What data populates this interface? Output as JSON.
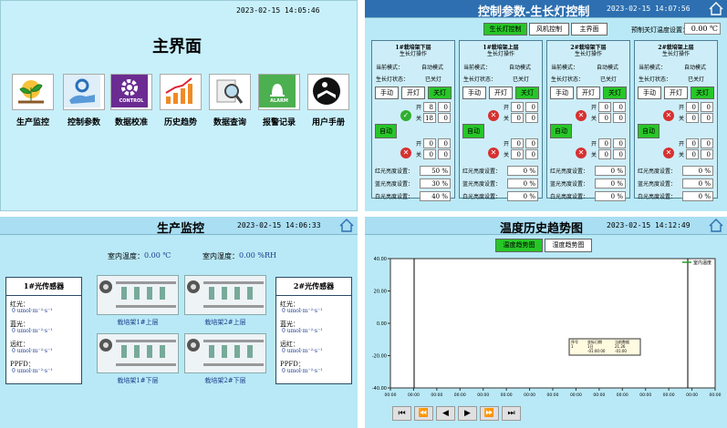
{
  "main_screen": {
    "datetime": "2023-02-15  14:05:46",
    "title": "主界面",
    "menu": [
      {
        "label": "生产监控",
        "icon": "plant-icon"
      },
      {
        "label": "控制参数",
        "icon": "hand-gear-icon"
      },
      {
        "label": "数据校准",
        "icon": "control-gear-icon",
        "badge": "CONTROL"
      },
      {
        "label": "历史趋势",
        "icon": "trend-chart-icon"
      },
      {
        "label": "数据查询",
        "icon": "magnifier-icon"
      },
      {
        "label": "报警记录",
        "icon": "alarm-bell-icon",
        "badge": "ALARM"
      },
      {
        "label": "用户手册",
        "icon": "manual-reader-icon"
      }
    ]
  },
  "control_screen": {
    "title": "控制参数-生长灯控制",
    "datetime": "2023-02-15  14:07:56",
    "tabs": [
      "生长灯控制",
      "风机控制",
      "主界面"
    ],
    "temp_label": "预制关灯温度设置：",
    "temp_value": "0.00 ℃",
    "groups": [
      {
        "name": "1#栽培架下层",
        "sub": "生长灯操作",
        "mode_label": "当前模式：",
        "mode": "自动模式",
        "state_label": "生长灯状态：",
        "state": "已关灯",
        "btn_manual": "手动",
        "btn_on": "开灯",
        "btn_off": "关灯",
        "btn_auto": "自动",
        "t_on_label": "开",
        "t_off_label": "关",
        "t1": [
          "8",
          "0"
        ],
        "t2": [
          "18",
          "0"
        ],
        "t3": [
          "0",
          "0"
        ],
        "t4": [
          "0",
          "0"
        ],
        "red_label": "红光亮度设置：",
        "red": "50 %",
        "blue_label": "蓝光亮度设置：",
        "blue": "30 %",
        "white_label": "白光亮度设置：",
        "white": "40 %"
      },
      {
        "name": "1#栽培架上层",
        "sub": "生长灯操作",
        "mode_label": "当前模式：",
        "mode": "自动模式",
        "state_label": "生长灯状态：",
        "state": "已关灯",
        "btn_manual": "手动",
        "btn_on": "开灯",
        "btn_off": "关灯",
        "btn_auto": "自动",
        "t_on_label": "开",
        "t_off_label": "关",
        "t1": [
          "0",
          "0"
        ],
        "t2": [
          "0",
          "0"
        ],
        "t3": [
          "0",
          "0"
        ],
        "t4": [
          "0",
          "0"
        ],
        "red_label": "红光亮度设置：",
        "red": "0 %",
        "blue_label": "蓝光亮度设置：",
        "blue": "0 %",
        "white_label": "白光亮度设置：",
        "white": "0 %"
      },
      {
        "name": "2#栽培架下层",
        "sub": "生长灯操作",
        "mode_label": "当前模式：",
        "mode": "自动模式",
        "state_label": "生长灯状态：",
        "state": "已关灯",
        "btn_manual": "手动",
        "btn_on": "开灯",
        "btn_off": "关灯",
        "btn_auto": "自动",
        "t_on_label": "开",
        "t_off_label": "关",
        "t1": [
          "0",
          "0"
        ],
        "t2": [
          "0",
          "0"
        ],
        "t3": [
          "0",
          "0"
        ],
        "t4": [
          "0",
          "0"
        ],
        "red_label": "红光亮度设置：",
        "red": "0 %",
        "blue_label": "蓝光亮度设置：",
        "blue": "0 %",
        "white_label": "白光亮度设置：",
        "white": "0 %"
      },
      {
        "name": "2#栽培架上层",
        "sub": "生长灯操作",
        "mode_label": "当前模式：",
        "mode": "自动模式",
        "state_label": "生长灯状态：",
        "state": "已关灯",
        "btn_manual": "手动",
        "btn_on": "开灯",
        "btn_off": "关灯",
        "btn_auto": "自动",
        "t_on_label": "开",
        "t_off_label": "关",
        "t1": [
          "0",
          "0"
        ],
        "t2": [
          "0",
          "0"
        ],
        "t3": [
          "0",
          "0"
        ],
        "t4": [
          "0",
          "0"
        ],
        "red_label": "红光亮度设置：",
        "red": "0 %",
        "blue_label": "蓝光亮度设置：",
        "blue": "0 %",
        "white_label": "白光亮度设置：",
        "white": "0 %"
      }
    ]
  },
  "monitor_screen": {
    "title": "生产监控",
    "datetime": "2023-02-15  14:06:33",
    "temp_label": "室内温度：",
    "temp_value": "0.00 ℃",
    "hum_label": "室内湿度：",
    "hum_value": "0.00 %RH",
    "sensors": [
      {
        "title": "1#光传感器",
        "rows": [
          {
            "label": "红光：",
            "value": "0 umol·m⁻²·s⁻¹"
          },
          {
            "label": "蓝光：",
            "value": "0 umol·m⁻²·s⁻¹"
          },
          {
            "label": "远红：",
            "value": "0 umol·m⁻²·s⁻¹"
          },
          {
            "label": "PPFD：",
            "value": "0 umol·m⁻²·s⁻¹"
          }
        ]
      },
      {
        "title": "2#光传感器",
        "rows": [
          {
            "label": "红光：",
            "value": "0 umol·m⁻²·s⁻¹"
          },
          {
            "label": "蓝光：",
            "value": "0 umol·m⁻²·s⁻¹"
          },
          {
            "label": "远红：",
            "value": "0 umol·m⁻²·s⁻¹"
          },
          {
            "label": "PPFD：",
            "value": "0 umol·m⁻²·s⁻¹"
          }
        ]
      }
    ],
    "shelves": [
      "栽培架1#上层",
      "栽培架2#上层",
      "栽培架1#下层",
      "栽培架2#下层"
    ]
  },
  "trend_screen": {
    "title": "温度历史趋势图",
    "datetime": "2023-02-15  14:12:49",
    "tabs": [
      "温度趋势图",
      "湿度趋势图"
    ],
    "legend": "室内温度",
    "y_ticks": [
      "40.00",
      "20.00",
      "0.00",
      "-20.00",
      "-40.00"
    ],
    "x_ticks": [
      "00:00",
      "00:00",
      "00:00",
      "00:00",
      "00:00",
      "00:00",
      "00:00",
      "00:00",
      "00:00",
      "00:00",
      "00:00",
      "00:00",
      "00:00",
      "00:00",
      "00:00"
    ],
    "info_headers": [
      "序号",
      "坐标日期",
      "当前数据"
    ],
    "info_row1": [
      "1",
      "1日",
      "21.26"
    ],
    "info_row2": [
      "",
      "-01:00:00",
      "-01:00"
    ],
    "nav": [
      "⏮",
      "⏪",
      "◀",
      "▶",
      "⏩",
      "⏭"
    ]
  },
  "chart_data": {
    "type": "line",
    "title": "温度历史趋势图",
    "ylim": [
      -40,
      40
    ],
    "y_ticks": [
      40,
      20,
      0,
      -20,
      -40
    ],
    "series": [
      {
        "name": "室内温度",
        "values": []
      }
    ],
    "grid": false,
    "legend": "top-right"
  },
  "colors": {
    "panel_bg": "#b9e9f6",
    "header_dark": "#2d6fb0",
    "active_green": "#27c627",
    "sensor_title": "#1a3a8a"
  }
}
